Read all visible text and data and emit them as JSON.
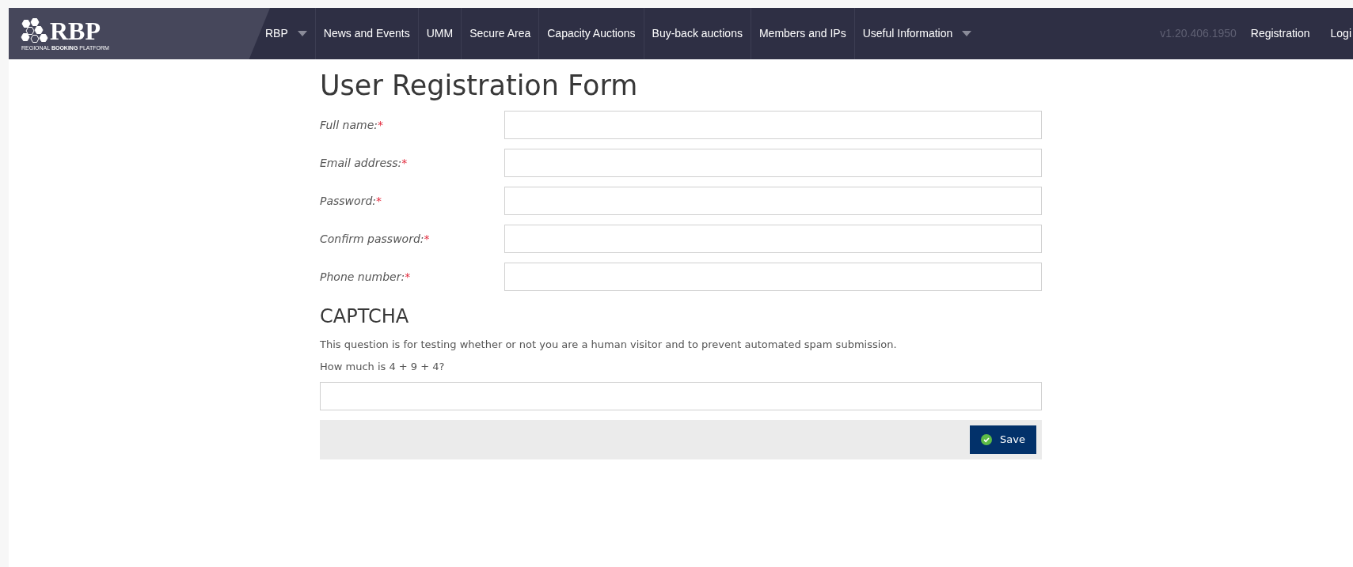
{
  "logo": {
    "name": "RBP",
    "tagline": "REGIONAL **BOOKING** PLATFORM"
  },
  "nav": [
    {
      "label": "RBP",
      "has_menu": true
    },
    {
      "label": "News and Events",
      "has_menu": false
    },
    {
      "label": "UMM",
      "has_menu": false
    },
    {
      "label": "Secure Area",
      "has_menu": false
    },
    {
      "label": "Capacity Auctions",
      "has_menu": false
    },
    {
      "label": "Buy-back auctions",
      "has_menu": false
    },
    {
      "label": "Members and IPs",
      "has_menu": false
    },
    {
      "label": "Useful Information",
      "has_menu": true
    }
  ],
  "version": "v1.20.406.1950",
  "nav_right": [
    "Registration",
    "Logi"
  ],
  "form": {
    "title": "User Registration Form",
    "fields": [
      {
        "label": "Full name:",
        "mark": "*"
      },
      {
        "label": "Email address:",
        "mark": "*"
      },
      {
        "label": "Password:",
        "mark": "*"
      },
      {
        "label": "Confirm password:",
        "mark": "*"
      },
      {
        "label": "Phone number:",
        "mark": "*"
      }
    ],
    "captcha": {
      "heading": "CAPTCHA",
      "description": "This question is for testing whether or not you are a human visitor and to prevent automated spam submission.",
      "question": "How much is 4 + 9 + 4?"
    },
    "save": "Save"
  }
}
